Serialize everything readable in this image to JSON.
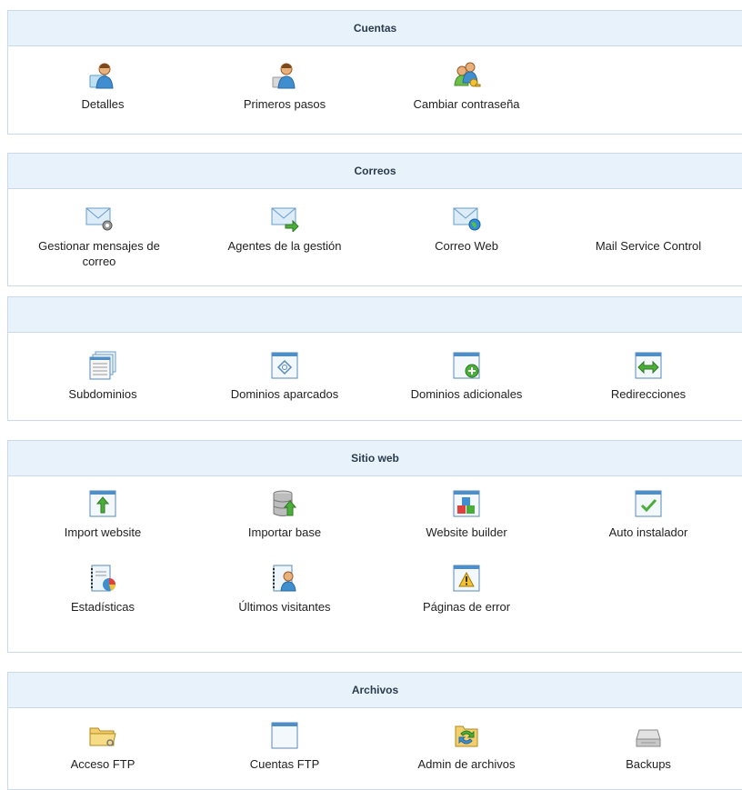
{
  "sections": [
    {
      "title": "Cuentas",
      "items": [
        {
          "label": "Detalles",
          "icon": "user-card-icon"
        },
        {
          "label": "Primeros pasos",
          "icon": "user-start-icon"
        },
        {
          "label": "Cambiar contraseña",
          "icon": "users-key-icon"
        }
      ]
    },
    {
      "title": "Correos",
      "items": [
        {
          "label": "Gestionar mensajes de correo",
          "icon": "mail-gear-icon"
        },
        {
          "label": "Agentes de la gestión",
          "icon": "mail-forward-icon"
        },
        {
          "label": "Correo Web",
          "icon": "mail-globe-icon"
        },
        {
          "label": "Mail Service Control",
          "icon": ""
        }
      ]
    },
    {
      "title": "",
      "items": [
        {
          "label": "Subdominios",
          "icon": "subdomains-icon"
        },
        {
          "label": "Dominios aparcados",
          "icon": "parked-domain-icon"
        },
        {
          "label": "Dominios adicionales",
          "icon": "addon-domain-icon"
        },
        {
          "label": "Redirecciones",
          "icon": "redirect-icon"
        }
      ]
    },
    {
      "title": "Sitio web",
      "items": [
        {
          "label": "Import website",
          "icon": "import-website-icon"
        },
        {
          "label": "Importar base",
          "icon": "import-database-icon"
        },
        {
          "label": "Website builder",
          "icon": "website-builder-icon"
        },
        {
          "label": "Auto instalador",
          "icon": "auto-installer-icon"
        },
        {
          "label": "Estadísticas",
          "icon": "statistics-icon"
        },
        {
          "label": "Últimos visitantes",
          "icon": "latest-visitors-icon"
        },
        {
          "label": "Páginas de error",
          "icon": "error-pages-icon"
        }
      ]
    },
    {
      "title": "Archivos",
      "items": [
        {
          "label": "Acceso FTP",
          "icon": "ftp-folder-icon"
        },
        {
          "label": "Cuentas FTP",
          "icon": "ftp-accounts-icon"
        },
        {
          "label": "Admin de archivos",
          "icon": "file-manager-icon"
        },
        {
          "label": "Backups",
          "icon": "backup-drive-icon"
        }
      ]
    }
  ]
}
